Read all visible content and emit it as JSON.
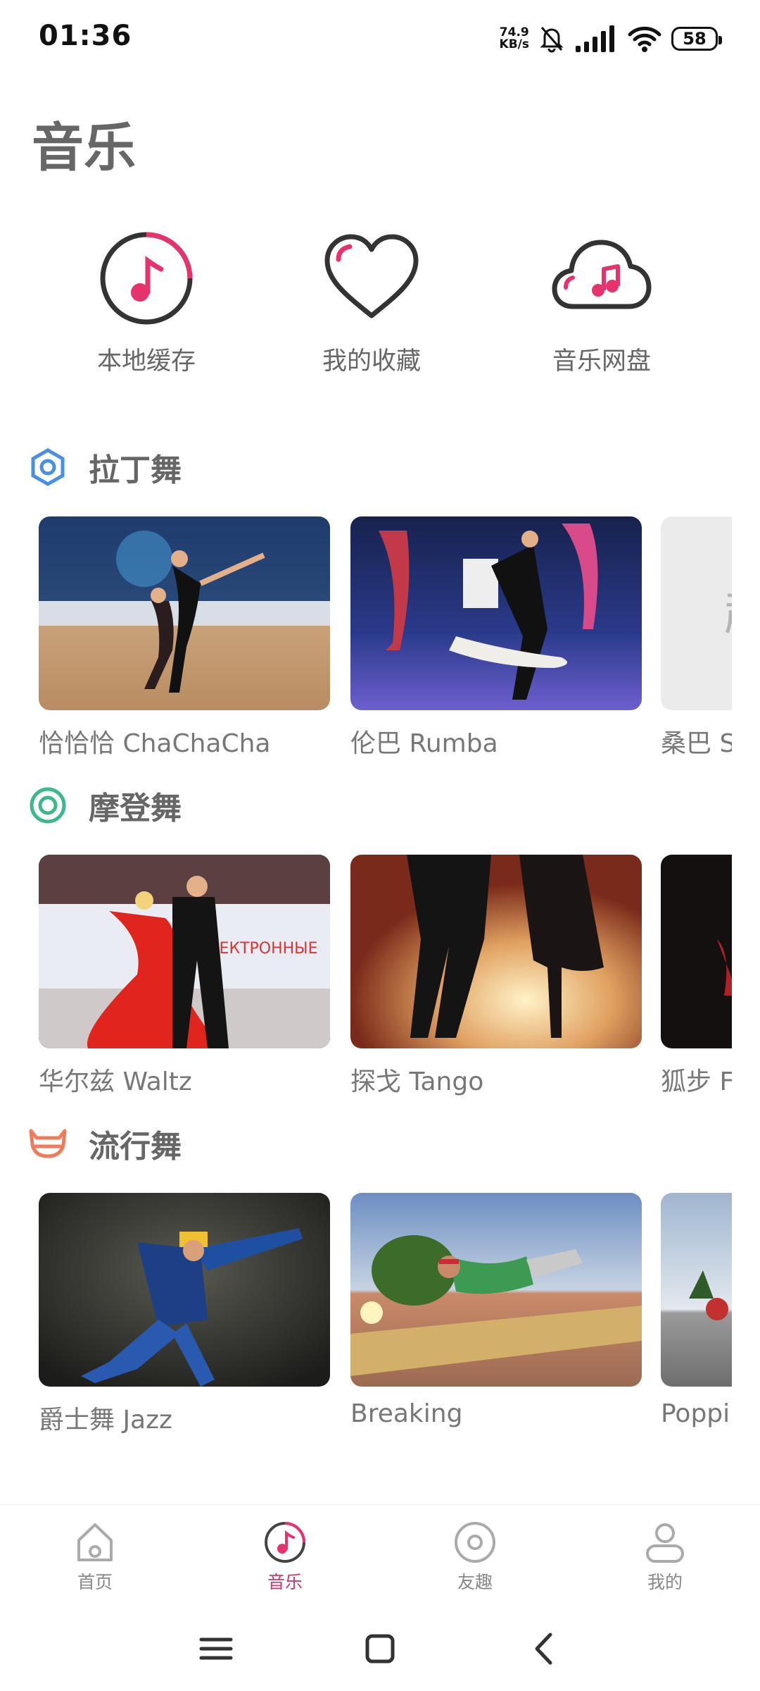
{
  "status": {
    "time": "01:36",
    "net_speed_value": "74.9",
    "net_speed_unit": "KB/s",
    "battery": "58"
  },
  "page": {
    "title": "音乐"
  },
  "quick_entries": [
    {
      "label": "本地缓存",
      "icon": "music-disc-icon"
    },
    {
      "label": "我的收藏",
      "icon": "heart-icon"
    },
    {
      "label": "音乐网盘",
      "icon": "cloud-music-icon"
    }
  ],
  "sections": [
    {
      "title": "拉丁舞",
      "icon": "hexagon-icon",
      "icon_color": "#4a90e2",
      "cards": [
        {
          "label": "恰恰恰 ChaChaCha"
        },
        {
          "label": "伦巴 Rumba"
        },
        {
          "label": "桑巴 S"
        }
      ]
    },
    {
      "title": "摩登舞",
      "icon": "ring-icon",
      "icon_color": "#3cb88a",
      "cards": [
        {
          "label": "华尔兹 Waltz"
        },
        {
          "label": "探戈 Tango"
        },
        {
          "label": "狐步 F"
        }
      ]
    },
    {
      "title": "流行舞",
      "icon": "horned-helmet-icon",
      "icon_color": "#f07b5b",
      "cards": [
        {
          "label": "爵士舞 Jazz"
        },
        {
          "label": "Breaking"
        },
        {
          "label": "Poppi"
        }
      ]
    }
  ],
  "bottom_nav": [
    {
      "label": "首页",
      "icon": "home-icon"
    },
    {
      "label": "音乐",
      "icon": "music-disc-icon",
      "active": true
    },
    {
      "label": "友趣",
      "icon": "disc-icon"
    },
    {
      "label": "我的",
      "icon": "user-icon"
    }
  ],
  "colors": {
    "accent": "#e6336c",
    "section_text": "#666666"
  }
}
